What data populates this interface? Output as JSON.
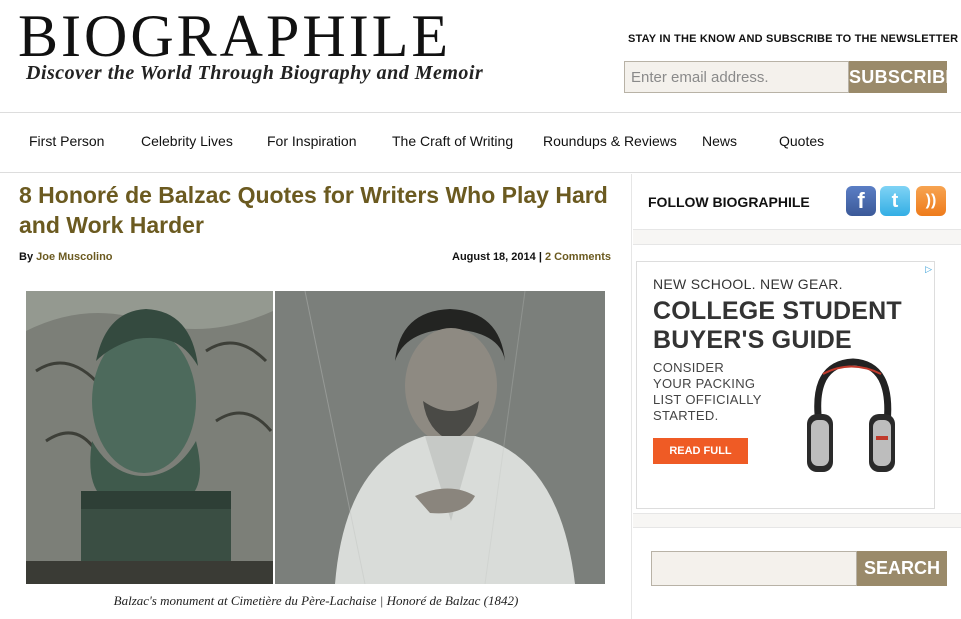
{
  "header": {
    "logo_title": "BIOGRAPHILE",
    "logo_tagline": "Discover the World Through Biography and Memoir",
    "newsletter_label": "STAY IN THE KNOW AND SUBSCRIBE TO THE NEWSLETTER",
    "email_placeholder": "Enter email address.",
    "subscribe_label": "SUBSCRIBE"
  },
  "nav": {
    "items": [
      "First Person",
      "Celebrity Lives",
      "For Inspiration",
      "The Craft of Writing",
      "Roundups & Reviews",
      "News",
      "Quotes"
    ]
  },
  "article": {
    "title": "8 Honoré de Balzac Quotes for Writers Who Play Hard and Work Harder",
    "by_label": "By",
    "author": "Joe Muscolino",
    "date": "August 18, 2014",
    "separator": "|",
    "comments": "2 Comments",
    "caption": "Balzac's monument at Cimetière du Père-Lachaise | Honoré de Balzac (1842)"
  },
  "sidebar": {
    "follow_label": "FOLLOW BIOGRAPHILE",
    "social": [
      {
        "name": "facebook-icon",
        "glyph": "f"
      },
      {
        "name": "twitter-icon",
        "glyph": "t"
      },
      {
        "name": "rss-icon",
        "glyph": "))"
      }
    ],
    "ad": {
      "choice_glyph": "▷",
      "kicker": "NEW SCHOOL. NEW GEAR.",
      "headline_1": "COLLEGE STUDENT",
      "headline_2": "BUYER'S GUIDE",
      "body_1": "CONSIDER",
      "body_2": "YOUR PACKING",
      "body_3": "LIST OFFICIALLY",
      "body_4": "STARTED.",
      "button": "READ FULL POST"
    },
    "search_label": "SEARCH"
  },
  "colors": {
    "accent_gold": "#6b5a20",
    "button_tan": "#9a8a6a",
    "ad_orange": "#ef5b25"
  }
}
